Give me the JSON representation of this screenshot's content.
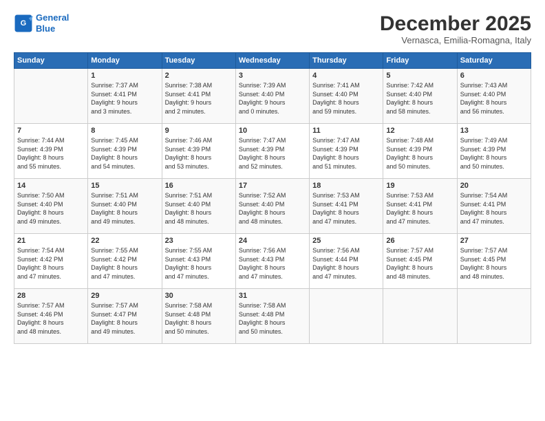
{
  "logo": {
    "line1": "General",
    "line2": "Blue"
  },
  "title": "December 2025",
  "subtitle": "Vernasca, Emilia-Romagna, Italy",
  "days_header": [
    "Sunday",
    "Monday",
    "Tuesday",
    "Wednesday",
    "Thursday",
    "Friday",
    "Saturday"
  ],
  "weeks": [
    [
      {
        "day": "",
        "info": ""
      },
      {
        "day": "1",
        "info": "Sunrise: 7:37 AM\nSunset: 4:41 PM\nDaylight: 9 hours\nand 3 minutes."
      },
      {
        "day": "2",
        "info": "Sunrise: 7:38 AM\nSunset: 4:41 PM\nDaylight: 9 hours\nand 2 minutes."
      },
      {
        "day": "3",
        "info": "Sunrise: 7:39 AM\nSunset: 4:40 PM\nDaylight: 9 hours\nand 0 minutes."
      },
      {
        "day": "4",
        "info": "Sunrise: 7:41 AM\nSunset: 4:40 PM\nDaylight: 8 hours\nand 59 minutes."
      },
      {
        "day": "5",
        "info": "Sunrise: 7:42 AM\nSunset: 4:40 PM\nDaylight: 8 hours\nand 58 minutes."
      },
      {
        "day": "6",
        "info": "Sunrise: 7:43 AM\nSunset: 4:40 PM\nDaylight: 8 hours\nand 56 minutes."
      }
    ],
    [
      {
        "day": "7",
        "info": "Sunrise: 7:44 AM\nSunset: 4:39 PM\nDaylight: 8 hours\nand 55 minutes."
      },
      {
        "day": "8",
        "info": "Sunrise: 7:45 AM\nSunset: 4:39 PM\nDaylight: 8 hours\nand 54 minutes."
      },
      {
        "day": "9",
        "info": "Sunrise: 7:46 AM\nSunset: 4:39 PM\nDaylight: 8 hours\nand 53 minutes."
      },
      {
        "day": "10",
        "info": "Sunrise: 7:47 AM\nSunset: 4:39 PM\nDaylight: 8 hours\nand 52 minutes."
      },
      {
        "day": "11",
        "info": "Sunrise: 7:47 AM\nSunset: 4:39 PM\nDaylight: 8 hours\nand 51 minutes."
      },
      {
        "day": "12",
        "info": "Sunrise: 7:48 AM\nSunset: 4:39 PM\nDaylight: 8 hours\nand 50 minutes."
      },
      {
        "day": "13",
        "info": "Sunrise: 7:49 AM\nSunset: 4:39 PM\nDaylight: 8 hours\nand 50 minutes."
      }
    ],
    [
      {
        "day": "14",
        "info": "Sunrise: 7:50 AM\nSunset: 4:40 PM\nDaylight: 8 hours\nand 49 minutes."
      },
      {
        "day": "15",
        "info": "Sunrise: 7:51 AM\nSunset: 4:40 PM\nDaylight: 8 hours\nand 49 minutes."
      },
      {
        "day": "16",
        "info": "Sunrise: 7:51 AM\nSunset: 4:40 PM\nDaylight: 8 hours\nand 48 minutes."
      },
      {
        "day": "17",
        "info": "Sunrise: 7:52 AM\nSunset: 4:40 PM\nDaylight: 8 hours\nand 48 minutes."
      },
      {
        "day": "18",
        "info": "Sunrise: 7:53 AM\nSunset: 4:41 PM\nDaylight: 8 hours\nand 47 minutes."
      },
      {
        "day": "19",
        "info": "Sunrise: 7:53 AM\nSunset: 4:41 PM\nDaylight: 8 hours\nand 47 minutes."
      },
      {
        "day": "20",
        "info": "Sunrise: 7:54 AM\nSunset: 4:41 PM\nDaylight: 8 hours\nand 47 minutes."
      }
    ],
    [
      {
        "day": "21",
        "info": "Sunrise: 7:54 AM\nSunset: 4:42 PM\nDaylight: 8 hours\nand 47 minutes."
      },
      {
        "day": "22",
        "info": "Sunrise: 7:55 AM\nSunset: 4:42 PM\nDaylight: 8 hours\nand 47 minutes."
      },
      {
        "day": "23",
        "info": "Sunrise: 7:55 AM\nSunset: 4:43 PM\nDaylight: 8 hours\nand 47 minutes."
      },
      {
        "day": "24",
        "info": "Sunrise: 7:56 AM\nSunset: 4:43 PM\nDaylight: 8 hours\nand 47 minutes."
      },
      {
        "day": "25",
        "info": "Sunrise: 7:56 AM\nSunset: 4:44 PM\nDaylight: 8 hours\nand 47 minutes."
      },
      {
        "day": "26",
        "info": "Sunrise: 7:57 AM\nSunset: 4:45 PM\nDaylight: 8 hours\nand 48 minutes."
      },
      {
        "day": "27",
        "info": "Sunrise: 7:57 AM\nSunset: 4:45 PM\nDaylight: 8 hours\nand 48 minutes."
      }
    ],
    [
      {
        "day": "28",
        "info": "Sunrise: 7:57 AM\nSunset: 4:46 PM\nDaylight: 8 hours\nand 48 minutes."
      },
      {
        "day": "29",
        "info": "Sunrise: 7:57 AM\nSunset: 4:47 PM\nDaylight: 8 hours\nand 49 minutes."
      },
      {
        "day": "30",
        "info": "Sunrise: 7:58 AM\nSunset: 4:48 PM\nDaylight: 8 hours\nand 50 minutes."
      },
      {
        "day": "31",
        "info": "Sunrise: 7:58 AM\nSunset: 4:48 PM\nDaylight: 8 hours\nand 50 minutes."
      },
      {
        "day": "",
        "info": ""
      },
      {
        "day": "",
        "info": ""
      },
      {
        "day": "",
        "info": ""
      }
    ]
  ]
}
